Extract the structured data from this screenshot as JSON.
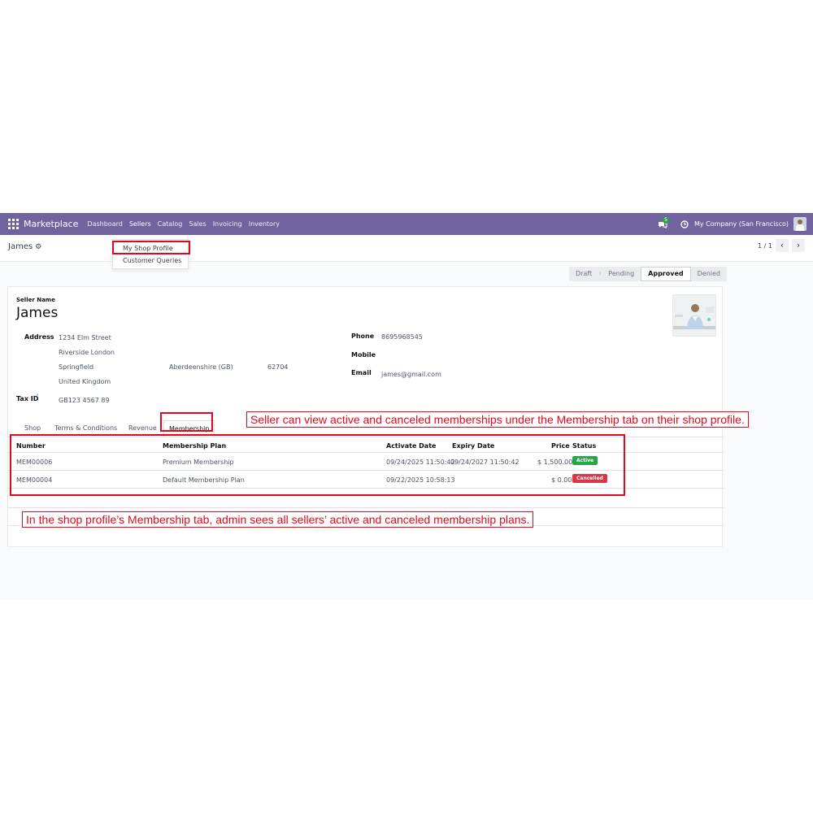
{
  "navbar": {
    "app_name": "Marketplace",
    "menu": [
      "Dashboard",
      "Sellers",
      "Catalog",
      "Sales",
      "Invoicing",
      "Inventory"
    ],
    "chat_badge": "5",
    "company": "My Company (San Francisco)",
    "bg_color": "#71639e"
  },
  "control": {
    "breadcrumb": "James",
    "pager": "1 / 1",
    "prev": "‹",
    "next": "›"
  },
  "dropdown": {
    "items": [
      "My Shop Profile",
      "Customer Queries"
    ]
  },
  "statusbar": {
    "stages": [
      "Draft",
      "Pending",
      "Approved",
      "Denied"
    ],
    "current": "Approved"
  },
  "form": {
    "seller_name_label": "Seller Name",
    "seller_name": "James",
    "address_label": "Address",
    "street": "1234 Elm Street",
    "street2": "Riverside London",
    "city": "Springfield",
    "state": "Aberdeenshire (GB)",
    "zip": "62704",
    "country": "United Kingdom",
    "tax_id_label": "Tax ID",
    "tax_help": "?",
    "tax_id": "GB123 4567 89",
    "phone_label": "Phone",
    "phone": "8695968545",
    "mobile_label": "Mobile",
    "email_label": "Email",
    "email": "james@gmail.com"
  },
  "tabs": [
    "Shop",
    "Terms & Conditions",
    "Revenue",
    "Membership"
  ],
  "table": {
    "headers": [
      "Number",
      "Membership Plan",
      "Activate Date",
      "Expiry Date",
      "Price",
      "Status"
    ],
    "rows": [
      {
        "number": "MEM00006",
        "plan": "Premium Membership",
        "activate": "09/24/2025 11:50:42",
        "expiry": "09/24/2027 11:50:42",
        "price": "$ 1,500.00",
        "status": "Active"
      },
      {
        "number": "MEM00004",
        "plan": "Default Membership Plan",
        "activate": "09/22/2025 10:58:13",
        "expiry": "",
        "price": "$ 0.00",
        "status": "Cancelled"
      }
    ]
  },
  "annotations": {
    "seller": "Seller can view active and canceled memberships under the Membership tab on their shop profile.",
    "admin": "In the shop profile’s Membership tab, admin sees all sellers’ active and canceled membership plans."
  },
  "colors": {
    "annotation_red": "#e2081c",
    "active_green": "#28a745",
    "cancelled_red": "#dc3545"
  }
}
